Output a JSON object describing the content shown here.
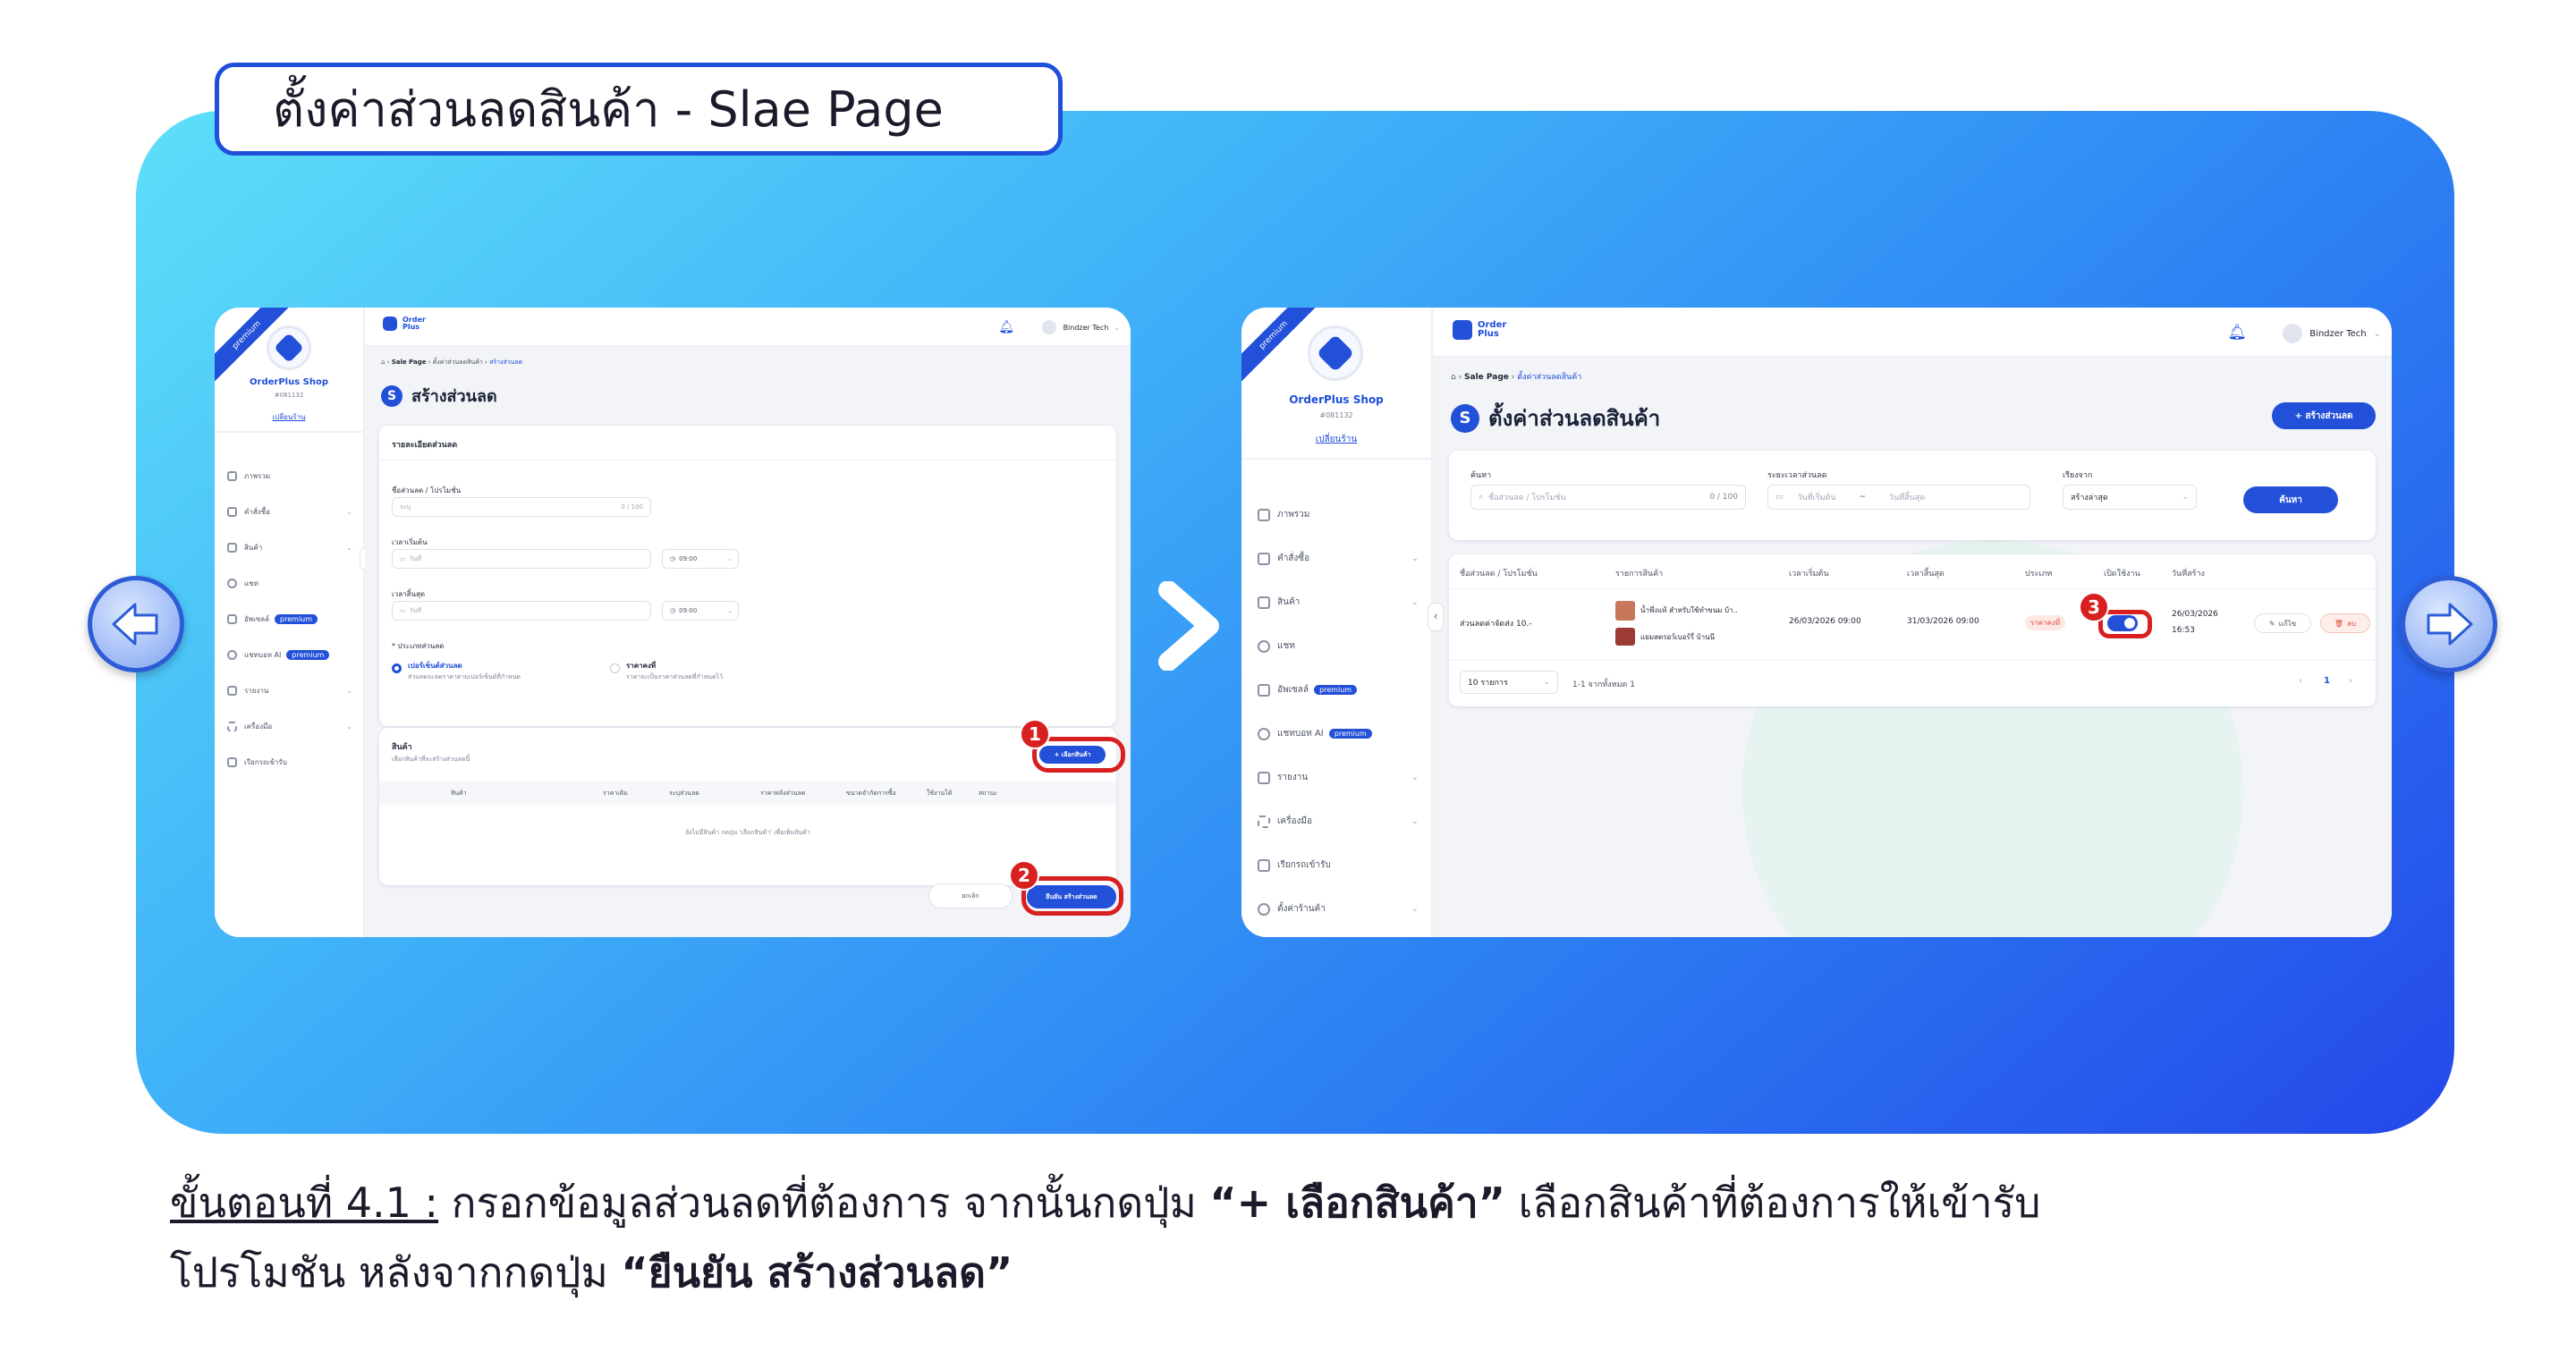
{
  "title": "ตั้งค่าส่วนลดสินค้า - Slae Page",
  "caption": {
    "step": "ขั้นตอนที่ 4.1 :",
    "text1": " กรอกข้อมูลส่วนลดที่ต้องการ จากนั้นกดปุ่ม ",
    "bold1": "“+ เลือกสินค้า”",
    "text2": " เลือกสินค้าที่ต้องการให้เข้ารับ",
    "text3": "โปรโมชัน หลังจากกดปุ่ม ",
    "bold2": "“ยืนยัน สร้างส่วนลด”"
  },
  "icons": {
    "prev": "arrow-left-icon",
    "next": "arrow-right-icon",
    "between": "chevron-right-icon"
  },
  "colors": {
    "accent": "#2350d9",
    "highlight": "#d92020"
  },
  "screenA": {
    "ribbon": "premium",
    "shop_name": "OrderPlus Shop",
    "shop_id": "#081132",
    "switch_shop": "เปลี่ยนร้าน",
    "menu": [
      "ภาพรวม",
      "คำสั่งซื้อ",
      "สินค้า",
      "แชท",
      "อัพเซลล์",
      "แชทบอท AI",
      "รายงาน",
      "เครื่องมือ",
      "เรียกรถเข้ารับ"
    ],
    "badge": "premium",
    "brand_line1": "Order",
    "brand_line2": "Plus",
    "user": "Bindzer Tech",
    "crumbs": [
      "Sale Page",
      "ตั้งค่าส่วนลดสินค้า",
      "สร้างส่วนลด"
    ],
    "page_title": "สร้างส่วนลด",
    "details_title": "รายละเอียดส่วนลด",
    "name_label": "ชื่อส่วนลด / โปรโมชั่น",
    "name_placeholder": "ระบุ",
    "name_counter": "0 / 100",
    "start_label": "เวลาเริ่มต้น",
    "date_placeholder": "วันที่",
    "time_value": "09:00",
    "end_label": "เวลาสิ้นสุด",
    "type_label": "* ประเภทส่วนลด",
    "opt1_title": "เปอร์เซ็นต์ส่วนลด",
    "opt1_desc": "ส่วนลดจะลดราคาตามเปอร์เซ็นต์ที่กำหนด",
    "opt2_title": "ราคาคงที่",
    "opt2_desc": "ราคาจะเป็นราคาส่วนลดที่กำหนดไว้",
    "products_title": "สินค้า",
    "products_sub": "เลือกสินค้าที่จะสร้างส่วนลดนี้",
    "select_btn": "+ เลือกสินค้า",
    "columns": [
      "สินค้า",
      "ราคาเดิม",
      "ระบุส่วนลด",
      "ราคาหลังส่วนลด",
      "ขนาดจำกัดการซื้อ",
      "ใช้งานได้",
      "สถานะ"
    ],
    "empty": "ยังไม่มีสินค้า กดปุ่ม 'เลือกสินค้า' เพื่อเพิ่มสินค้า",
    "cancel_btn": "ยกเลิก",
    "confirm_btn": "ยืนยัน สร้างส่วนลด",
    "badge1": "1",
    "badge2": "2"
  },
  "screenB": {
    "ribbon": "premium",
    "shop_name": "OrderPlus Shop",
    "shop_id": "#081132",
    "switch_shop": "เปลี่ยนร้าน",
    "menu": [
      "ภาพรวม",
      "คำสั่งซื้อ",
      "สินค้า",
      "แชท",
      "อัพเซลล์",
      "แชทบอท AI",
      "รายงาน",
      "เครื่องมือ",
      "เรียกรถเข้ารับ",
      "ตั้งค่าร้านค้า"
    ],
    "badge": "premium",
    "brand_line1": "Order",
    "brand_line2": "Plus",
    "user": "Bindzer Tech",
    "crumbs": [
      "Sale Page",
      "ตั้งค่าส่วนลดสินค้า"
    ],
    "page_title": "ตั้งค่าส่วนลดสินค้า",
    "create_btn": "+ สร้างส่วนลด",
    "search_label": "ค้นหา",
    "search_placeholder": "ชื่อส่วนลด / โปรโมชั่น",
    "search_counter": "0 / 100",
    "period_label": "ระยะเวลาส่วนลด",
    "start_placeholder": "วันที่เริ่มต้น",
    "end_placeholder": "วันที่สิ้นสุด",
    "sort_label": "เรียงจาก",
    "sort_value": "สร้างล่าสุด",
    "search_btn": "ค้นหา",
    "columns": [
      "ชื่อส่วนลด / โปรโมชั่น",
      "รายการสินค้า",
      "เวลาเริ่มต้น",
      "เวลาสิ้นสุด",
      "ประเภท",
      "เปิดใช้งาน",
      "วันที่สร้าง"
    ],
    "row": {
      "name": "ส่วนลดค่าจัดส่ง 10.-",
      "product1": "น้ำพึ่งแท้ สำหรับใช้ทำขนม บ้า..",
      "product2": "แยมสตรอว์เบอร์รี่ บ้านนี",
      "start": "26/03/2026 09:00",
      "end": "31/03/2026 09:00",
      "type": "ราคาคงที่",
      "enabled": true,
      "created_date": "26/03/2026",
      "created_time": "16:53",
      "edit": "แก้ไข",
      "delete": "ลบ"
    },
    "per_page": "10 รายการ",
    "range": "1-1 จากทั้งหมด 1",
    "page": "1",
    "badge3": "3"
  }
}
